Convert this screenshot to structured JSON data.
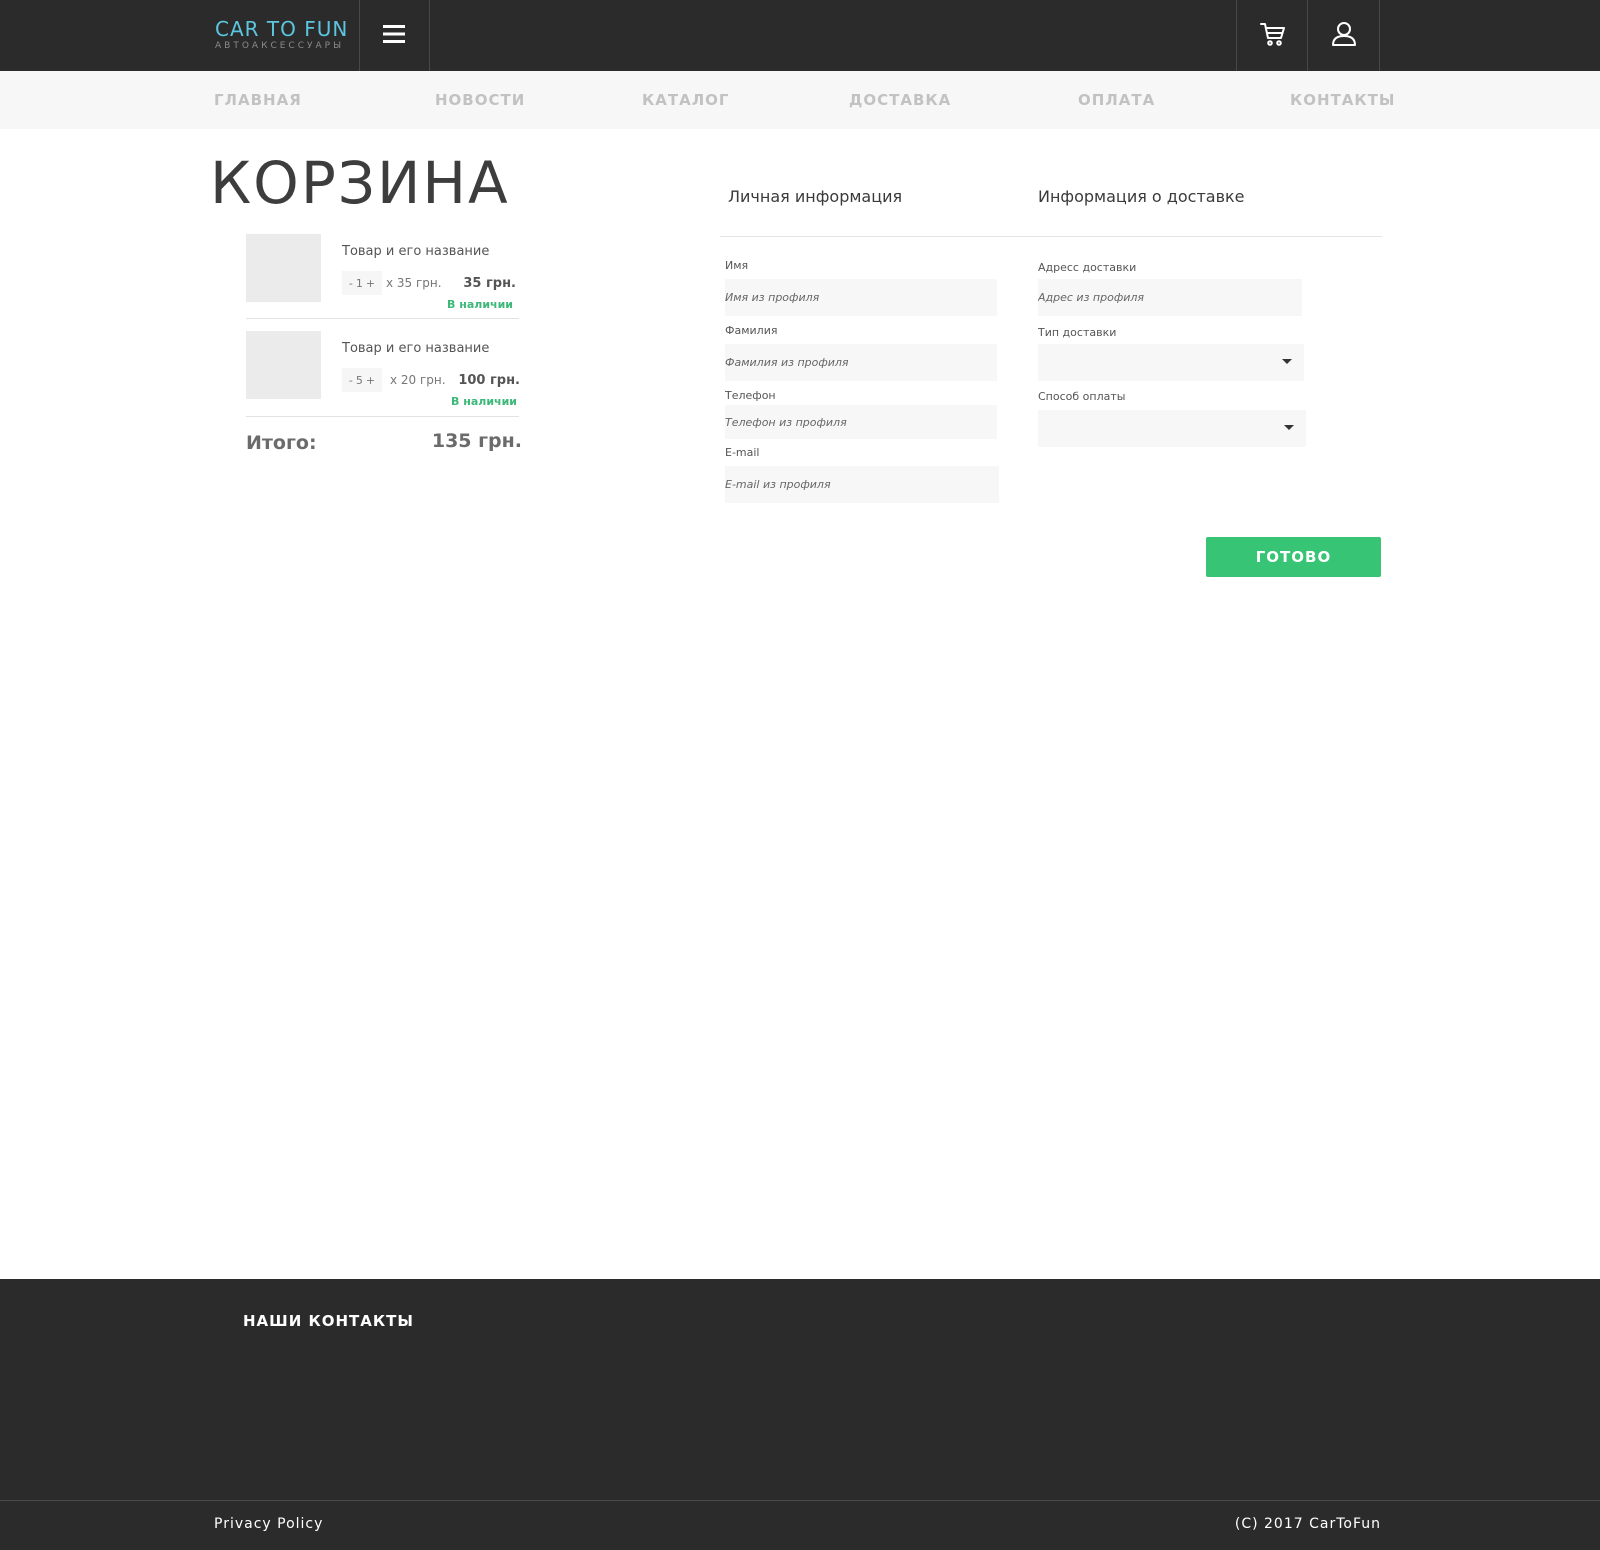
{
  "header": {
    "logo_title": "CAR TO FUN",
    "logo_subtitle": "АВТОАКСЕССУАРЫ",
    "menu_icon": "hamburger-icon",
    "cart_icon": "cart-icon",
    "user_icon": "user-icon"
  },
  "nav": {
    "items": [
      {
        "label": "ГЛАВНАЯ"
      },
      {
        "label": "НОВОСТИ"
      },
      {
        "label": "КАТАЛОГ"
      },
      {
        "label": "ДОСТАВКА"
      },
      {
        "label": "ОПЛАТА"
      },
      {
        "label": "КОНТАКТЫ"
      }
    ]
  },
  "cart": {
    "title": "КОРЗИНА",
    "items": [
      {
        "name": "Товар и его название",
        "qty_minus": "-",
        "qty": "1",
        "qty_plus": "+",
        "unit_price": "x 35 грн.",
        "price": "35 грн.",
        "stock": "В наличии"
      },
      {
        "name": "Товар и его название",
        "qty_minus": "-",
        "qty": "5",
        "qty_plus": "+",
        "unit_price": "x 20 грн.",
        "price": "100 грн.",
        "stock": "В наличии"
      }
    ],
    "total_label": "Итого:",
    "total_value": "135 грн."
  },
  "form": {
    "personal_title": "Личная информация",
    "delivery_title": "Информация о доставке",
    "first_name": {
      "label": "Имя",
      "placeholder": "Имя из профиля"
    },
    "last_name": {
      "label": "Фамилия",
      "placeholder": "Фамилия из профиля"
    },
    "phone": {
      "label": "Телефон",
      "placeholder": "Телефон из профиля"
    },
    "email": {
      "label": "E-mail",
      "placeholder": "E-mail из профиля"
    },
    "address": {
      "label": "Адресс доставки",
      "placeholder": "Адрес из профиля"
    },
    "delivery_type": {
      "label": "Тип доставки",
      "value": ""
    },
    "payment_method": {
      "label": "Способ оплаты",
      "value": ""
    },
    "submit_label": "ГОТОВО"
  },
  "footer": {
    "title": "НАШИ КОНТАКТЫ",
    "privacy": "Privacy Policy",
    "copyright": "(C) 2017 CarToFun"
  },
  "colors": {
    "header_bg": "#2b2b2b",
    "logo": "#5cc6de",
    "accent_green": "#37c475",
    "stock_green": "#3cb878"
  }
}
